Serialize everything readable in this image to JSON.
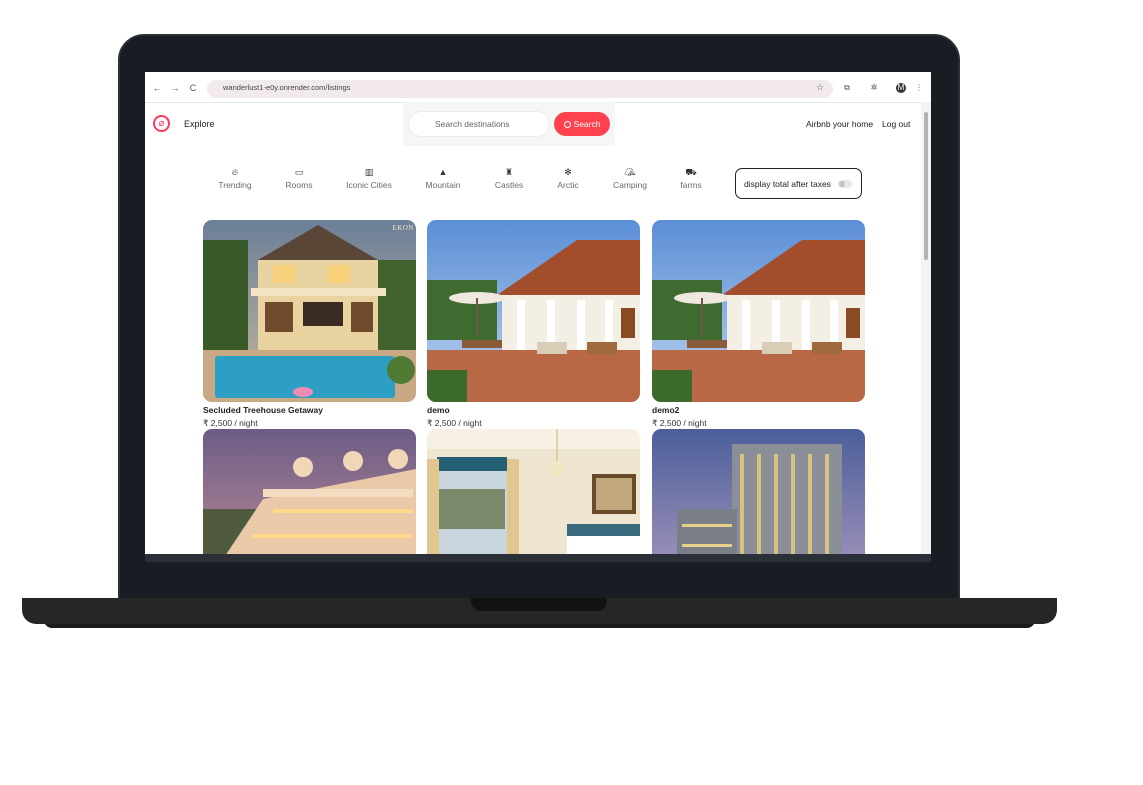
{
  "browser": {
    "url": "wanderlust1-e0y.onrender.com/listings"
  },
  "navbar": {
    "explore": "Explore",
    "search_placeholder": "Search destinations",
    "search_button": "Search",
    "airbnb_your_home": "Airbnb your home",
    "logout": "Log out"
  },
  "filters": [
    {
      "label": "Trending",
      "icon": "fire-icon"
    },
    {
      "label": "Rooms",
      "icon": "bed-icon"
    },
    {
      "label": "Iconic Cities",
      "icon": "city-icon"
    },
    {
      "label": "Mountain",
      "icon": "mountain-icon"
    },
    {
      "label": "Castles",
      "icon": "castle-icon"
    },
    {
      "label": "Arctic",
      "icon": "snowflake-icon"
    },
    {
      "label": "Camping",
      "icon": "tent-icon"
    },
    {
      "label": "farms",
      "icon": "tractor-icon"
    }
  ],
  "tax_toggle": {
    "label": "display total after taxes",
    "enabled": false
  },
  "listings": [
    {
      "title": "Secluded Treehouse Getaway",
      "price": "₹ 2,500 / night",
      "image": "villa-pool",
      "watermark": "EKON"
    },
    {
      "title": "demo",
      "price": "₹ 2,500 / night",
      "image": "colonial-villa"
    },
    {
      "title": "demo2",
      "price": "₹ 2,500 / night",
      "image": "colonial-villa"
    },
    {
      "title": "",
      "price": "",
      "image": "palace-dusk"
    },
    {
      "title": "",
      "price": "",
      "image": "hotel-room"
    },
    {
      "title": "",
      "price": "",
      "image": "hotel-tower"
    }
  ],
  "colors": {
    "brand": "#fe424d",
    "bezel": "#171d23",
    "text": "#222222"
  }
}
